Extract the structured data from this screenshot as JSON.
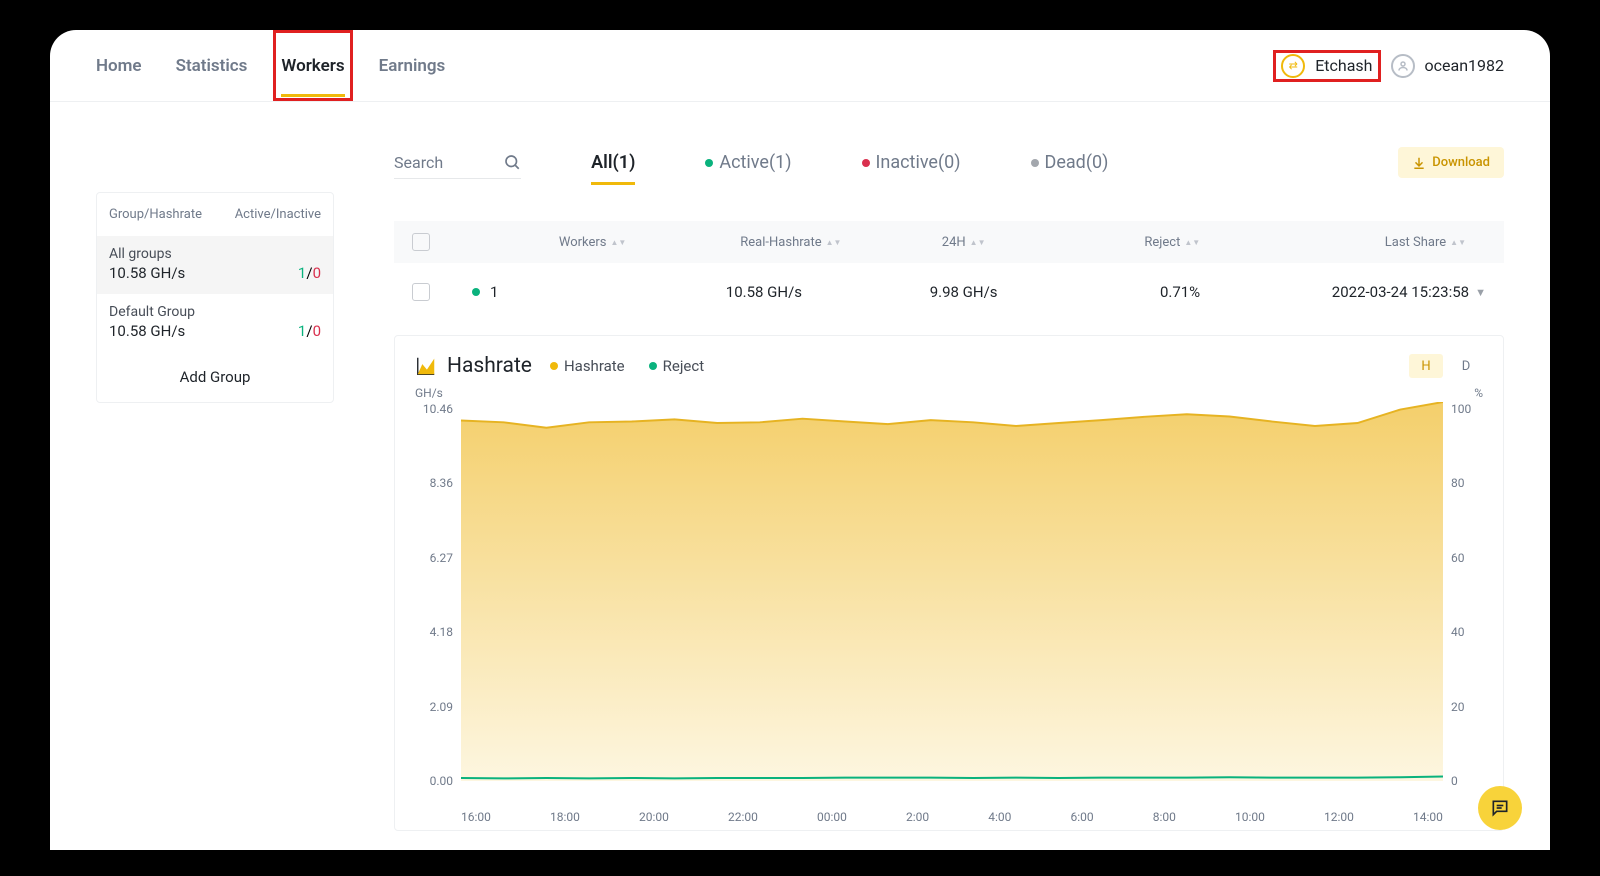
{
  "nav": {
    "items": [
      "Home",
      "Statistics",
      "Workers",
      "Earnings"
    ],
    "activeIndex": 2
  },
  "account": {
    "coin": "Etchash",
    "user": "ocean1982"
  },
  "sidebar": {
    "head": {
      "c1": "Group/Hashrate",
      "c2": "Active/Inactive"
    },
    "rows": [
      {
        "name": "All groups",
        "rate": "10.58 GH/s",
        "active": "1",
        "inactive": "0",
        "selected": true
      },
      {
        "name": "Default Group",
        "rate": "10.58 GH/s",
        "active": "1",
        "inactive": "0",
        "selected": false
      }
    ],
    "add": "Add Group"
  },
  "filters": {
    "search": "Search",
    "tabs": [
      {
        "label": "All(1)",
        "dot": null,
        "active": true
      },
      {
        "label": "Active(1)",
        "dot": "green"
      },
      {
        "label": "Inactive(0)",
        "dot": "red"
      },
      {
        "label": "Dead(0)",
        "dot": "grey"
      }
    ],
    "download": "Download"
  },
  "table": {
    "head": [
      "Workers",
      "Real-Hashrate",
      "24H",
      "Reject",
      "Last Share"
    ],
    "row": {
      "worker": "1",
      "real": "10.58 GH/s",
      "h24": "9.98 GH/s",
      "reject": "0.71%",
      "last": "2022-03-24 15:23:58"
    }
  },
  "chart": {
    "title": "Hashrate",
    "legend": [
      "Hashrate",
      "Reject"
    ],
    "toggle": [
      "H",
      "D"
    ],
    "yunit": "GH/s",
    "yunit_r": "%",
    "yticks": [
      "10.46",
      "8.36",
      "6.27",
      "4.18",
      "2.09",
      "0.00"
    ],
    "yticks_r": [
      "100",
      "80",
      "60",
      "40",
      "20",
      "0"
    ],
    "xticks": [
      "16:00",
      "18:00",
      "20:00",
      "22:00",
      "00:00",
      "2:00",
      "4:00",
      "6:00",
      "8:00",
      "10:00",
      "12:00",
      "14:00"
    ]
  },
  "chart_data": {
    "type": "area-line-dual-axis",
    "title": "Hashrate",
    "x": [
      "16:00",
      "17:00",
      "18:00",
      "19:00",
      "20:00",
      "21:00",
      "22:00",
      "23:00",
      "00:00",
      "1:00",
      "2:00",
      "3:00",
      "4:00",
      "5:00",
      "6:00",
      "7:00",
      "8:00",
      "9:00",
      "10:00",
      "11:00",
      "12:00",
      "13:00",
      "14:00",
      "15:00"
    ],
    "series": [
      {
        "name": "Hashrate",
        "axis": "left",
        "unit": "GH/s",
        "values": [
          9.95,
          9.9,
          9.75,
          9.9,
          9.92,
          9.98,
          9.88,
          9.9,
          10.0,
          9.92,
          9.85,
          9.96,
          9.9,
          9.8,
          9.88,
          9.96,
          10.05,
          10.12,
          10.06,
          9.92,
          9.8,
          9.88,
          10.25,
          10.46
        ]
      },
      {
        "name": "Reject",
        "axis": "right",
        "unit": "%",
        "values": [
          0.8,
          0.7,
          0.8,
          0.7,
          0.8,
          0.7,
          0.8,
          0.8,
          0.8,
          0.9,
          0.9,
          0.9,
          0.8,
          0.9,
          0.8,
          0.9,
          0.9,
          0.9,
          1.0,
          0.9,
          0.9,
          0.9,
          1.0,
          1.2
        ]
      }
    ],
    "ylim_left": [
      0,
      10.46
    ],
    "ylim_right": [
      0,
      100
    ],
    "xlabel": "",
    "ylabel_left": "GH/s",
    "ylabel_right": "%"
  }
}
